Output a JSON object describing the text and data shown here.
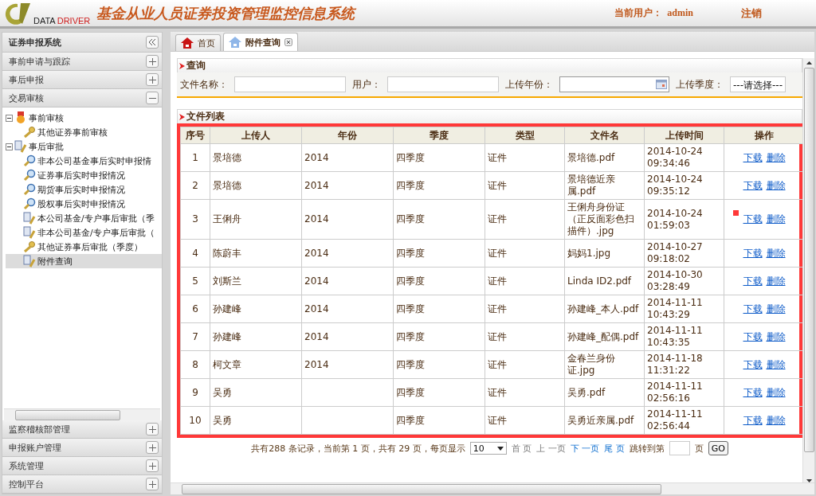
{
  "header": {
    "logo_words": [
      "DATA",
      "DRIVER"
    ],
    "title": "基金从业人员证券投资管理监控信息系统",
    "user_label": "当前用户：",
    "user_name": "admin",
    "logout": "注销"
  },
  "sidebar": {
    "title": "证券申报系统",
    "sections": [
      {
        "label": "事前申请与跟踪",
        "expanded": false
      },
      {
        "label": "事后申报",
        "expanded": false
      },
      {
        "label": "交易审核",
        "expanded": true,
        "tree": [
          {
            "label": "事前审核",
            "kind": "medal",
            "expanded": true,
            "selected": false,
            "children": [
              {
                "label": "其他证券事前审核",
                "kind": "key",
                "selected": false
              }
            ]
          },
          {
            "label": "事后审批",
            "kind": "document",
            "expanded": true,
            "selected": false,
            "children": [
              {
                "label": "非本公司基金事后实时申报情",
                "kind": "search",
                "selected": false
              },
              {
                "label": "证券事后实时申报情况",
                "kind": "search",
                "selected": false
              },
              {
                "label": "期货事后实时申报情况",
                "kind": "search",
                "selected": false
              },
              {
                "label": "股权事后实时申报情况",
                "kind": "search",
                "selected": false
              },
              {
                "label": "本公司基金/专户事后审批（季",
                "kind": "document",
                "selected": false
              },
              {
                "label": "非本公司基金/专户事后审批（",
                "kind": "document",
                "selected": false
              },
              {
                "label": "其他证券事后审批（季度）",
                "kind": "key",
                "selected": false
              },
              {
                "label": "附件查询",
                "kind": "document",
                "selected": true
              }
            ]
          }
        ]
      },
      {
        "label": "监察稽核部管理",
        "expanded": false
      },
      {
        "label": "申报账户管理",
        "expanded": false
      },
      {
        "label": "系统管理",
        "expanded": false
      },
      {
        "label": "控制平台",
        "expanded": false
      }
    ]
  },
  "tabs": [
    {
      "label": "首页",
      "kind": "home",
      "selected": false,
      "closable": false
    },
    {
      "label": "附件查询",
      "kind": "page",
      "selected": true,
      "closable": true
    }
  ],
  "query": {
    "title": "查询",
    "fields": [
      {
        "label": "文件名称：",
        "kind": "text"
      },
      {
        "label": "用户：",
        "kind": "text"
      },
      {
        "label": "上传年份：",
        "kind": "date"
      },
      {
        "label": "上传季度：",
        "kind": "select",
        "value": "---请选择---"
      }
    ]
  },
  "file_list": {
    "title": "文件列表",
    "columns": [
      "序号",
      "上传人",
      "年份",
      "季度",
      "类型",
      "文件名",
      "上传时间",
      "操作"
    ],
    "rows": [
      {
        "no": "1",
        "uploader": "景培德",
        "year": "2014",
        "quarter": "四季度",
        "type": "证件",
        "file": "景培德.pdf",
        "time": [
          "2014-10-24",
          "09:34:46"
        ],
        "marked": false,
        "actions": [
          "下载",
          "删除"
        ]
      },
      {
        "no": "2",
        "uploader": "景培德",
        "year": "2014",
        "quarter": "四季度",
        "type": "证件",
        "file": "景培德近亲属.pdf",
        "time": [
          "2014-10-24",
          "09:35:12"
        ],
        "marked": false,
        "actions": [
          "下载",
          "删除"
        ]
      },
      {
        "no": "3",
        "uploader": "王俐舟",
        "year": "2014",
        "quarter": "四季度",
        "type": "证件",
        "file": "王俐舟身份证（正反面彩色扫描件）.jpg",
        "time": [
          "2014-10-24",
          "01:59:03"
        ],
        "marked": true,
        "actions": [
          "下载",
          "删除"
        ]
      },
      {
        "no": "4",
        "uploader": "陈蔚丰",
        "year": "2014",
        "quarter": "四季度",
        "type": "证件",
        "file": "妈妈1.jpg",
        "time": [
          "2014-10-27",
          "09:18:02"
        ],
        "marked": false,
        "actions": [
          "下载",
          "删除"
        ]
      },
      {
        "no": "5",
        "uploader": "刘斯兰",
        "year": "2014",
        "quarter": "四季度",
        "type": "证件",
        "file": "Linda ID2.pdf",
        "time": [
          "2014-10-30",
          "03:28:49"
        ],
        "marked": false,
        "actions": [
          "下载",
          "删除"
        ]
      },
      {
        "no": "6",
        "uploader": "孙建峰",
        "year": "2014",
        "quarter": "四季度",
        "type": "证件",
        "file": "孙建峰_本人.pdf",
        "time": [
          "2014-11-11",
          "10:43:29"
        ],
        "marked": false,
        "actions": [
          "下载",
          "删除"
        ]
      },
      {
        "no": "7",
        "uploader": "孙建峰",
        "year": "2014",
        "quarter": "四季度",
        "type": "证件",
        "file": "孙建峰_配偶.pdf",
        "time": [
          "2014-11-11",
          "10:43:35"
        ],
        "marked": false,
        "actions": [
          "下载",
          "删除"
        ]
      },
      {
        "no": "8",
        "uploader": "柯文章",
        "year": "2014",
        "quarter": "四季度",
        "type": "证件",
        "file": "金春兰身份证.jpg",
        "time": [
          "2014-11-18",
          "11:31:22"
        ],
        "marked": false,
        "actions": [
          "下载",
          "删除"
        ]
      },
      {
        "no": "9",
        "uploader": "吴勇",
        "quarter": "四季度",
        "type": "证件",
        "file": "吴勇.pdf",
        "time": [
          "2014-11-11",
          "02:56:16"
        ],
        "marked": false,
        "actions": [
          "下载",
          "删除"
        ]
      },
      {
        "no": "10",
        "uploader": "吴勇",
        "quarter": "四季度",
        "type": "证件",
        "file": "吴勇近亲属.pdf",
        "time": [
          "2014-11-11",
          "02:56:44"
        ],
        "marked": false,
        "actions": [
          "下载",
          "删除"
        ]
      }
    ]
  },
  "pagination": {
    "summary": "共有288 条记录，当前第 1 页，共有 29 页，每页显示",
    "page_size": "10",
    "links": [
      {
        "label": "首 页",
        "disabled": true
      },
      {
        "label": "上 一页",
        "disabled": true
      },
      {
        "label": "下 一页",
        "disabled": false
      },
      {
        "label": "尾 页",
        "disabled": false
      }
    ],
    "jump_label": "跳转到第",
    "page_unit": "页",
    "go": "GO"
  }
}
